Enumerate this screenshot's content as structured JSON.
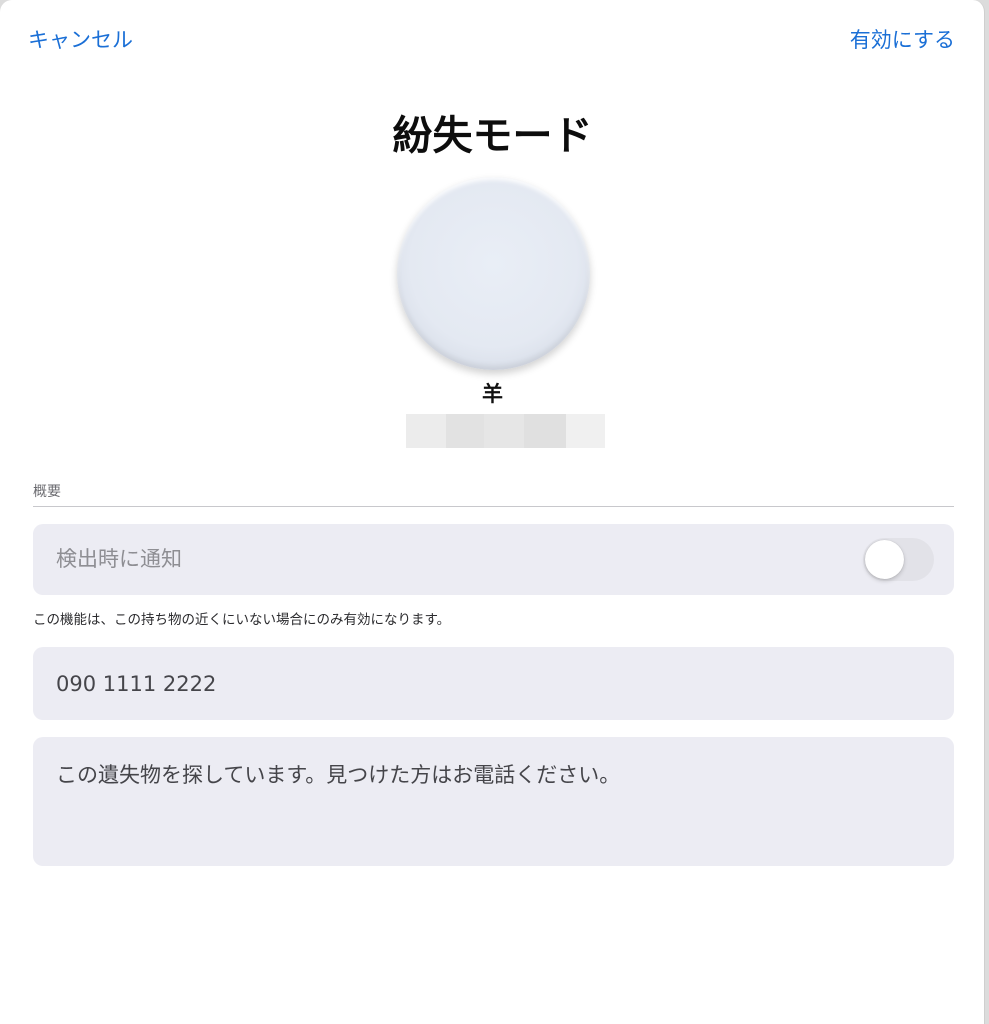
{
  "nav": {
    "cancel_label": "キャンセル",
    "enable_label": "有効にする"
  },
  "title": "紛失モード",
  "item": {
    "icon": "airtag-icon",
    "name": "羊"
  },
  "section": {
    "label": "概要"
  },
  "notify_row": {
    "label": "検出時に通知",
    "toggle_on": false
  },
  "footnote": "この機能は、この持ち物の近くにいない場合にのみ有効になります。",
  "phone_field": {
    "value": "090 1111 2222"
  },
  "message_field": {
    "value": "この遺失物を探しています。見つけた方はお電話ください。"
  },
  "colors": {
    "accent": "#1a6fd6",
    "row_background": "#ececf3",
    "secondary_text": "#8e8e93"
  }
}
